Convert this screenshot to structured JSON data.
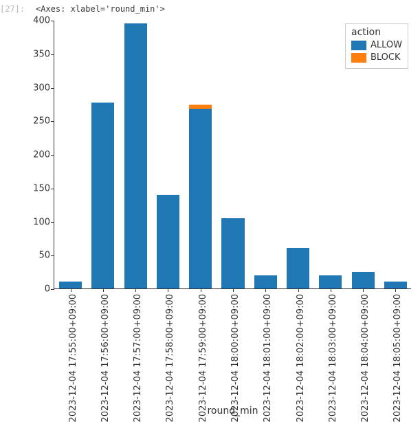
{
  "cell": {
    "prompt": "[27]:",
    "repr": "<Axes: xlabel='round_min'>"
  },
  "chart_data": {
    "type": "bar",
    "stacked": true,
    "categories": [
      "2023-12-04 17:55:00+09:00",
      "2023-12-04 17:56:00+09:00",
      "2023-12-04 17:57:00+09:00",
      "2023-12-04 17:58:00+09:00",
      "2023-12-04 17:59:00+09:00",
      "2023-12-04 18:00:00+09:00",
      "2023-12-04 18:01:00+09:00",
      "2023-12-04 18:02:00+09:00",
      "2023-12-04 18:03:00+09:00",
      "2023-12-04 18:04:00+09:00",
      "2023-12-04 18:05:00+09:00"
    ],
    "series": [
      {
        "name": "ALLOW",
        "color": "#1f77b4",
        "values": [
          10,
          277,
          395,
          139,
          268,
          105,
          20,
          61,
          20,
          25,
          10
        ]
      },
      {
        "name": "BLOCK",
        "color": "#ff7f0e",
        "values": [
          0,
          0,
          0,
          0,
          6,
          0,
          0,
          0,
          0,
          0,
          0
        ]
      }
    ],
    "xlabel": "round_min",
    "ylabel": "",
    "ylim": [
      0,
      400
    ],
    "yticks": [
      0,
      50,
      100,
      150,
      200,
      250,
      300,
      350,
      400
    ],
    "legend": {
      "title": "action",
      "position": "upper right"
    }
  }
}
